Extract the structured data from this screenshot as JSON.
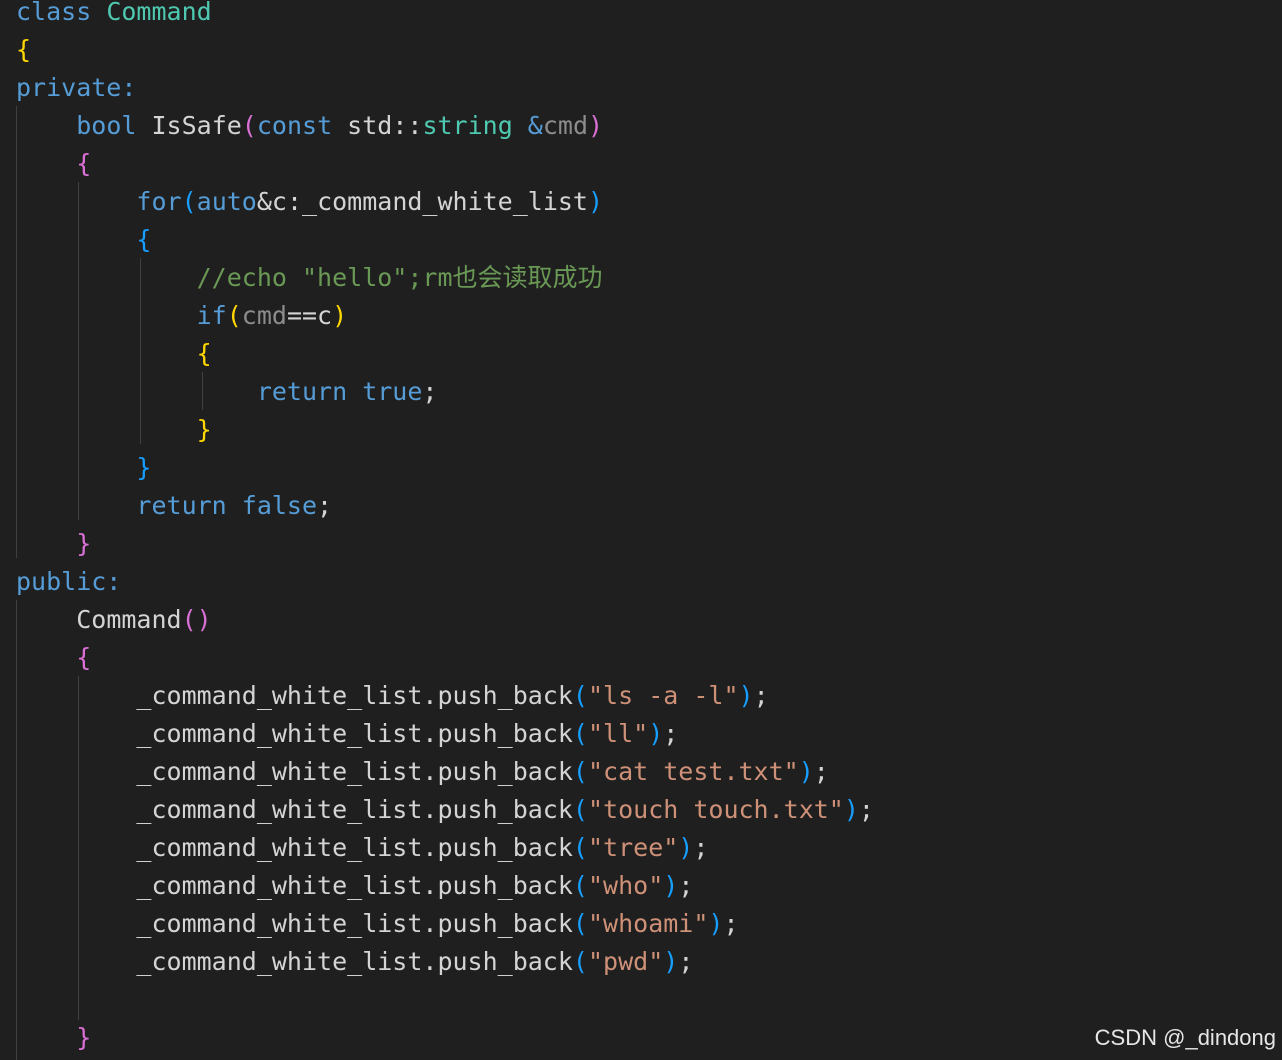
{
  "editor": {
    "colors": {
      "background": "#1f1f1f",
      "default": "#d4d4d4",
      "keyword": "#569cd6",
      "control": "#c586c0",
      "type": "#4ec9b0",
      "function": "#dcdcaa",
      "string": "#ce9178",
      "comment": "#6a9955",
      "param": "#9cdcfe",
      "param_dim": "#8c8c8c",
      "bracket_gold": "#ffd700",
      "bracket_pink": "#da70d6",
      "bracket_blue": "#179fff",
      "indent_guide": "#404040"
    },
    "lines": [
      {
        "t": [
          {
            "s": "class ",
            "c": "keyword"
          },
          {
            "s": "Command",
            "c": "type"
          }
        ]
      },
      {
        "t": [
          {
            "s": "{",
            "c": "bracket_gold"
          }
        ]
      },
      {
        "t": [
          {
            "s": "private:",
            "c": "keyword"
          }
        ]
      },
      {
        "t": [
          {
            "s": "    "
          },
          {
            "s": "bool ",
            "c": "keyword"
          },
          {
            "s": "IsSafe",
            "c": "default"
          },
          {
            "s": "(",
            "c": "bracket_pink"
          },
          {
            "s": "const ",
            "c": "keyword"
          },
          {
            "s": "std::",
            "c": "default"
          },
          {
            "s": "string ",
            "c": "type"
          },
          {
            "s": "&",
            "c": "keyword"
          },
          {
            "s": "cmd",
            "c": "param_dim"
          },
          {
            "s": ")",
            "c": "bracket_pink"
          }
        ]
      },
      {
        "t": [
          {
            "s": "    "
          },
          {
            "s": "{",
            "c": "bracket_pink"
          }
        ]
      },
      {
        "t": [
          {
            "s": "        "
          },
          {
            "s": "for",
            "c": "keyword"
          },
          {
            "s": "(",
            "c": "bracket_blue"
          },
          {
            "s": "auto",
            "c": "keyword"
          },
          {
            "s": "&c:_command_white_list",
            "c": "default"
          },
          {
            "s": ")",
            "c": "bracket_blue"
          }
        ]
      },
      {
        "t": [
          {
            "s": "        "
          },
          {
            "s": "{",
            "c": "bracket_blue"
          }
        ]
      },
      {
        "t": [
          {
            "s": "            "
          },
          {
            "s": "//echo \"hello\";rm也会读取成功",
            "c": "comment"
          }
        ]
      },
      {
        "t": [
          {
            "s": "            "
          },
          {
            "s": "if",
            "c": "keyword"
          },
          {
            "s": "(",
            "c": "bracket_gold"
          },
          {
            "s": "cmd",
            "c": "param_dim"
          },
          {
            "s": "==c",
            "c": "default"
          },
          {
            "s": ")",
            "c": "bracket_gold"
          }
        ]
      },
      {
        "t": [
          {
            "s": "            "
          },
          {
            "s": "{",
            "c": "bracket_gold"
          }
        ]
      },
      {
        "t": [
          {
            "s": "                "
          },
          {
            "s": "return ",
            "c": "keyword"
          },
          {
            "s": "true",
            "c": "keyword"
          },
          {
            "s": ";",
            "c": "default"
          }
        ]
      },
      {
        "t": [
          {
            "s": "            "
          },
          {
            "s": "}",
            "c": "bracket_gold"
          }
        ]
      },
      {
        "t": [
          {
            "s": "        "
          },
          {
            "s": "}",
            "c": "bracket_blue"
          }
        ]
      },
      {
        "t": [
          {
            "s": "        "
          },
          {
            "s": "return ",
            "c": "keyword"
          },
          {
            "s": "false",
            "c": "keyword"
          },
          {
            "s": ";",
            "c": "default"
          }
        ]
      },
      {
        "t": [
          {
            "s": "    "
          },
          {
            "s": "}",
            "c": "bracket_pink"
          }
        ]
      },
      {
        "t": [
          {
            "s": "public:",
            "c": "keyword"
          }
        ]
      },
      {
        "t": [
          {
            "s": "    "
          },
          {
            "s": "Command",
            "c": "default"
          },
          {
            "s": "()",
            "c": "bracket_pink"
          }
        ]
      },
      {
        "t": [
          {
            "s": "    "
          },
          {
            "s": "{",
            "c": "bracket_pink"
          }
        ]
      },
      {
        "t": [
          {
            "s": "        "
          },
          {
            "s": "_command_white_list.push_back",
            "c": "default"
          },
          {
            "s": "(",
            "c": "bracket_blue"
          },
          {
            "s": "\"ls -a -l\"",
            "c": "string"
          },
          {
            "s": ")",
            "c": "bracket_blue"
          },
          {
            "s": ";",
            "c": "default"
          }
        ]
      },
      {
        "t": [
          {
            "s": "        "
          },
          {
            "s": "_command_white_list.push_back",
            "c": "default"
          },
          {
            "s": "(",
            "c": "bracket_blue"
          },
          {
            "s": "\"ll\"",
            "c": "string"
          },
          {
            "s": ")",
            "c": "bracket_blue"
          },
          {
            "s": ";",
            "c": "default"
          }
        ]
      },
      {
        "t": [
          {
            "s": "        "
          },
          {
            "s": "_command_white_list.push_back",
            "c": "default"
          },
          {
            "s": "(",
            "c": "bracket_blue"
          },
          {
            "s": "\"cat test.txt\"",
            "c": "string"
          },
          {
            "s": ")",
            "c": "bracket_blue"
          },
          {
            "s": ";",
            "c": "default"
          }
        ]
      },
      {
        "t": [
          {
            "s": "        "
          },
          {
            "s": "_command_white_list.push_back",
            "c": "default"
          },
          {
            "s": "(",
            "c": "bracket_blue"
          },
          {
            "s": "\"touch touch.txt\"",
            "c": "string"
          },
          {
            "s": ")",
            "c": "bracket_blue"
          },
          {
            "s": ";",
            "c": "default"
          }
        ]
      },
      {
        "t": [
          {
            "s": "        "
          },
          {
            "s": "_command_white_list.push_back",
            "c": "default"
          },
          {
            "s": "(",
            "c": "bracket_blue"
          },
          {
            "s": "\"tree\"",
            "c": "string"
          },
          {
            "s": ")",
            "c": "bracket_blue"
          },
          {
            "s": ";",
            "c": "default"
          }
        ]
      },
      {
        "t": [
          {
            "s": "        "
          },
          {
            "s": "_command_white_list.push_back",
            "c": "default"
          },
          {
            "s": "(",
            "c": "bracket_blue"
          },
          {
            "s": "\"who\"",
            "c": "string"
          },
          {
            "s": ")",
            "c": "bracket_blue"
          },
          {
            "s": ";",
            "c": "default"
          }
        ]
      },
      {
        "t": [
          {
            "s": "        "
          },
          {
            "s": "_command_white_list.push_back",
            "c": "default"
          },
          {
            "s": "(",
            "c": "bracket_blue"
          },
          {
            "s": "\"whoami\"",
            "c": "string"
          },
          {
            "s": ")",
            "c": "bracket_blue"
          },
          {
            "s": ";",
            "c": "default"
          }
        ]
      },
      {
        "t": [
          {
            "s": "        "
          },
          {
            "s": "_command_white_list.push_back",
            "c": "default"
          },
          {
            "s": "(",
            "c": "bracket_blue"
          },
          {
            "s": "\"pwd\"",
            "c": "string"
          },
          {
            "s": ")",
            "c": "bracket_blue"
          },
          {
            "s": ";",
            "c": "default"
          }
        ]
      },
      {
        "t": []
      },
      {
        "t": [
          {
            "s": "    "
          },
          {
            "s": "}",
            "c": "bracket_pink"
          }
        ]
      }
    ]
  },
  "watermark": "CSDN @_dindong"
}
